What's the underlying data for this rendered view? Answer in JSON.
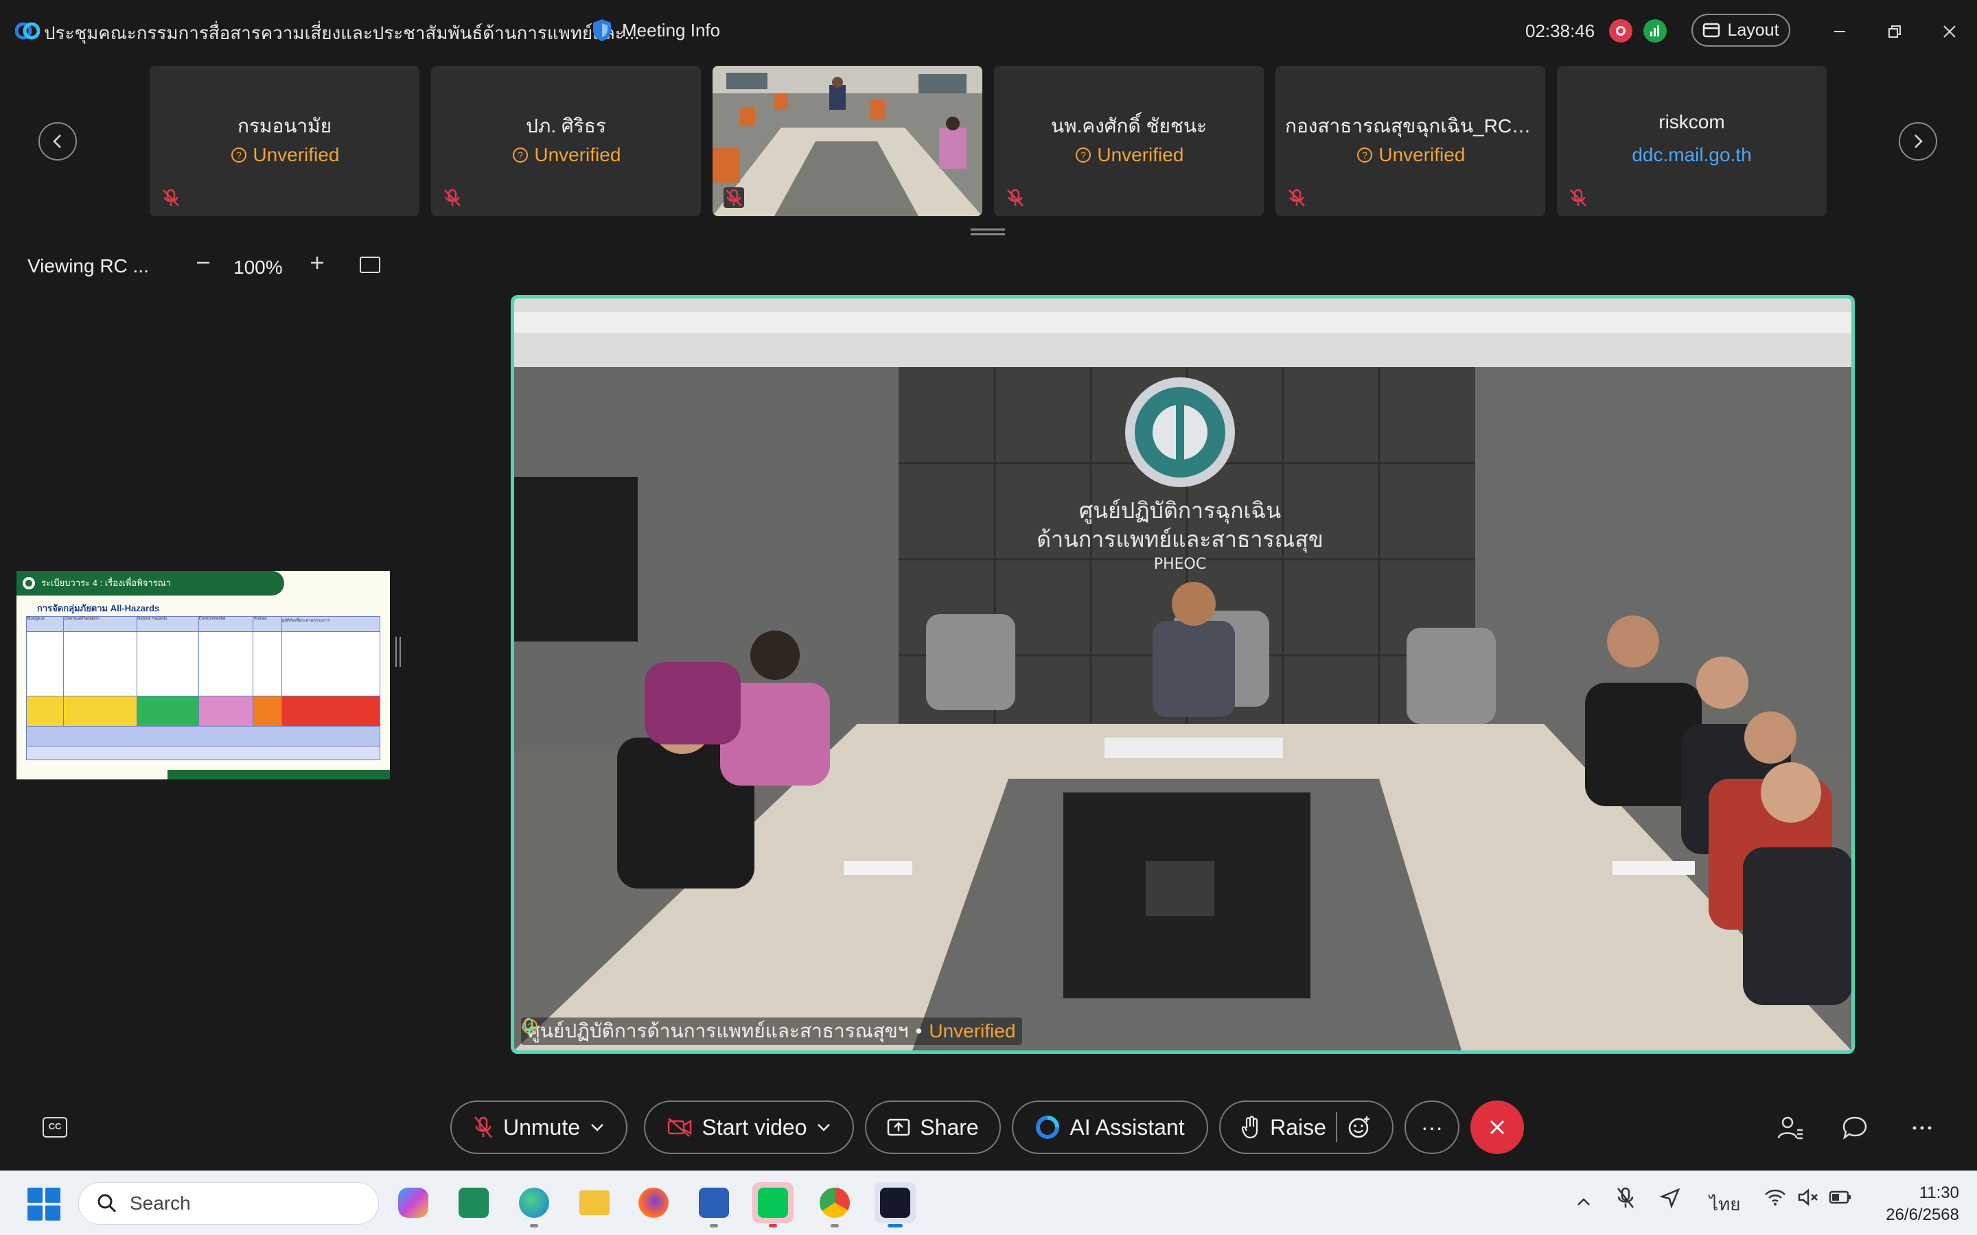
{
  "window": {
    "title": "ประชุมคณะกรรมการสื่อสารความเสี่ยงและประชาสัมพันธ์ด้านการแพทย์และ...",
    "meeting_info_label": "Meeting Info",
    "timer": "02:38:46",
    "layout_label": "Layout"
  },
  "participants": [
    {
      "name": "กรมอนามัย",
      "status": "Unverified"
    },
    {
      "name": "ปภ. ศิริธร",
      "status": "Unverified"
    },
    {
      "name": "",
      "status": ""
    },
    {
      "name": "นพ.คงศักดิ์ ชัยชนะ",
      "status": "Unverified"
    },
    {
      "name": "กองสาธารณสุขฉุกเฉิน_RC_ส...",
      "status": "Unverified"
    },
    {
      "name": "riskcom",
      "status": "ddc.mail.go.th"
    }
  ],
  "viewing": {
    "label": "Viewing RC ...",
    "zoom": "100%"
  },
  "slide": {
    "header": "ระเบียบวาระ 4 : เรื่องเพื่อพิจารณา",
    "subtitle": "การจัดกลุ่มภัยตาม All-Hazards",
    "columns": [
      "Biological",
      "Chemical/Radiation",
      "Natural Hazards",
      "Environmental",
      "Human",
      "อุบัติภัยเพื่อระหายกรรมการ"
    ]
  },
  "main_video": {
    "speaker": "ศูนย์ปฏิบัติการด้านการแพทย์และสาธารณสุขฯ",
    "separator": "•",
    "status": "Unverified",
    "wall_sign_line1": "ศูนย์ปฏิบัติการฉุกเฉิน",
    "wall_sign_line2": "ด้านการแพทย์และสาธารณสุข",
    "wall_sign_line3": "PHEOC"
  },
  "controls": {
    "unmute": "Unmute",
    "start_video": "Start video",
    "share": "Share",
    "ai_assistant": "AI Assistant",
    "raise": "Raise",
    "more": "···",
    "cc": "CC"
  },
  "taskbar": {
    "search_placeholder": "Search",
    "language": "ไทย",
    "time": "11:30",
    "date": "26/6/2568"
  },
  "colors": {
    "accent_border": "#4fd6b4",
    "unverified": "#f1a43a",
    "verified_domain": "#4ea6f5",
    "end_call": "#e0303e"
  }
}
